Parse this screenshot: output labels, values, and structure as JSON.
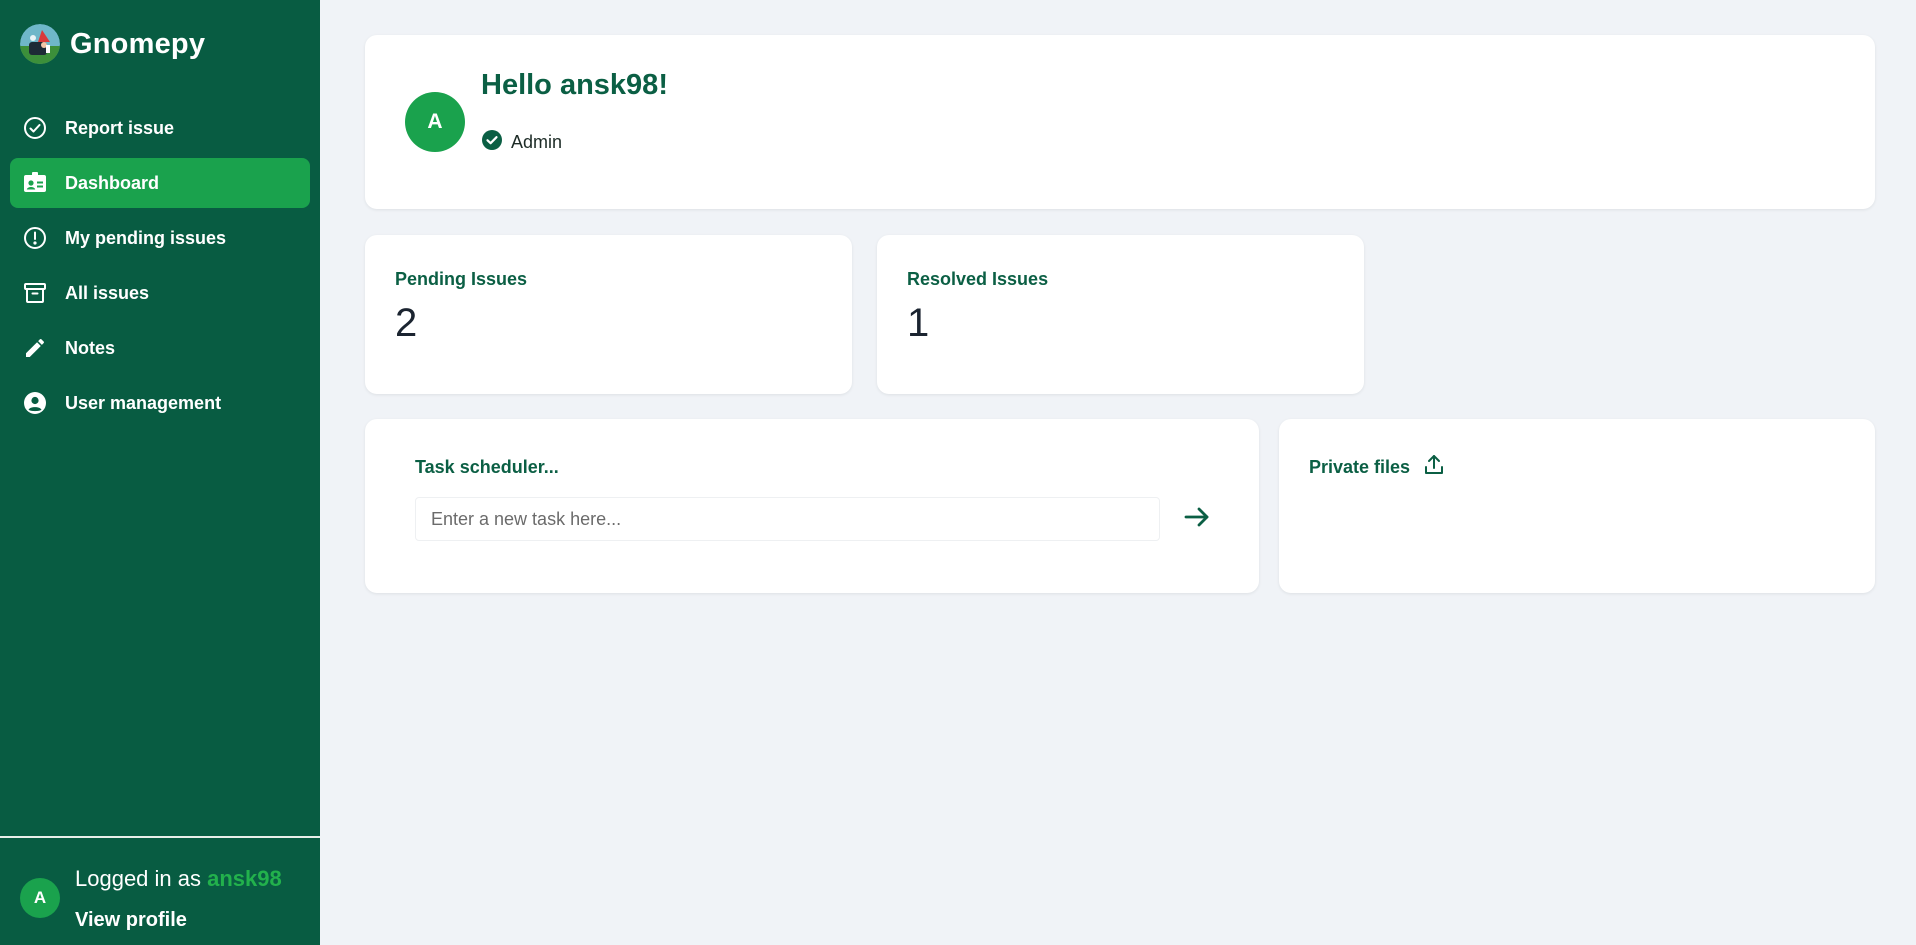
{
  "brand": {
    "name": "Gnomepy",
    "logo_icon": "gnome-logo-icon"
  },
  "sidebar": {
    "items": [
      {
        "label": "Report issue",
        "icon": "check-circle-icon",
        "active": false
      },
      {
        "label": "Dashboard",
        "icon": "id-card-icon",
        "active": true
      },
      {
        "label": "My pending issues",
        "icon": "exclamation-circle-icon",
        "active": false
      },
      {
        "label": "All issues",
        "icon": "archive-icon",
        "active": false
      },
      {
        "label": "Notes",
        "icon": "pencil-icon",
        "active": false
      },
      {
        "label": "User management",
        "icon": "user-circle-icon",
        "active": false
      }
    ],
    "footer": {
      "avatar_letter": "A",
      "logged_in_prefix": "Logged in as ",
      "username": "ansk98",
      "view_profile": "View profile"
    }
  },
  "greeting": {
    "avatar_letter": "A",
    "title": "Hello ansk98!",
    "role": "Admin"
  },
  "stats": {
    "pending": {
      "label": "Pending Issues",
      "value": "2"
    },
    "resolved": {
      "label": "Resolved Issues",
      "value": "1"
    }
  },
  "task_scheduler": {
    "title": "Task scheduler...",
    "placeholder": "Enter a new task here..."
  },
  "private_files": {
    "title": "Private files"
  },
  "colors": {
    "sidebar_bg": "#085c42",
    "accent_green": "#1aa24d",
    "heading_green": "#0b5f44",
    "page_bg": "#f0f3f7"
  }
}
